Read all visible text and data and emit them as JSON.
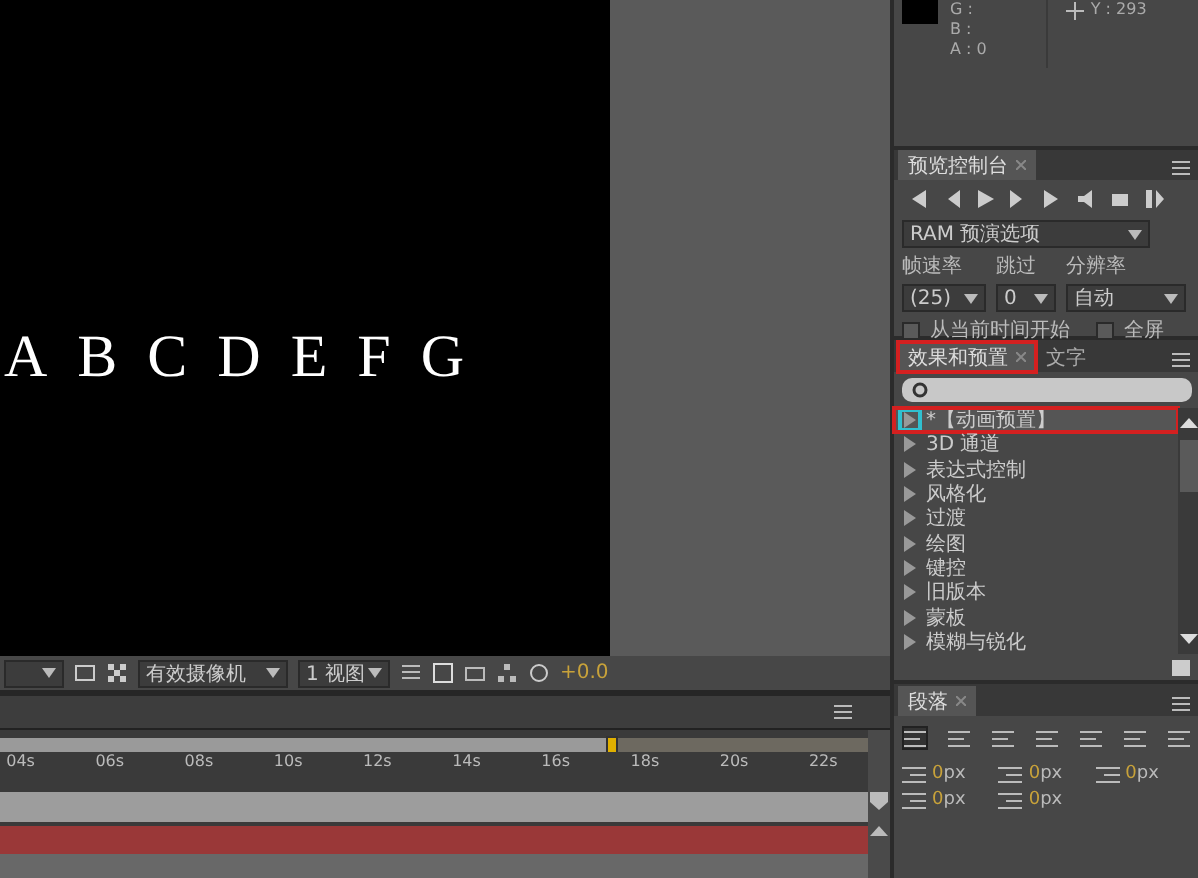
{
  "viewer": {
    "text": "ABCDEFG",
    "toolbar": {
      "camera": "有效摄像机",
      "views": "1 视图",
      "exposure": "+0.0"
    }
  },
  "timeline": {
    "ticks": [
      "04s",
      "06s",
      "08s",
      "10s",
      "12s",
      "14s",
      "16s",
      "18s",
      "20s",
      "22s"
    ]
  },
  "info": {
    "lines": [
      "G :",
      "B :",
      "A : 0"
    ],
    "coords": "Y : 293"
  },
  "preview": {
    "tab": "预览控制台",
    "ram_options": "RAM 预演选项",
    "labels": [
      "帧速率",
      "跳过",
      "分辨率"
    ],
    "frame_rate": "(25)",
    "skip": "0",
    "resolution": "自动",
    "checkboxes": [
      {
        "label": "从当前时间开始",
        "checked": false
      },
      {
        "label": "全屏",
        "checked": false
      }
    ]
  },
  "effects": {
    "tabs": [
      {
        "label": "效果和预置",
        "selected": true,
        "annotated": true
      },
      {
        "label": "文字",
        "selected": false,
        "annotated": false
      }
    ],
    "items": [
      {
        "label": "*【动画预置】",
        "selected": true,
        "annotated": true
      },
      {
        "label": "3D 通道",
        "selected": false,
        "annotated": false
      },
      {
        "label": "表达式控制",
        "selected": false,
        "annotated": false
      },
      {
        "label": "风格化",
        "selected": false,
        "annotated": false
      },
      {
        "label": "过渡",
        "selected": false,
        "annotated": false
      },
      {
        "label": "绘图",
        "selected": false,
        "annotated": false
      },
      {
        "label": "键控",
        "selected": false,
        "annotated": false
      },
      {
        "label": "旧版本",
        "selected": false,
        "annotated": false
      },
      {
        "label": "蒙板",
        "selected": false,
        "annotated": false
      },
      {
        "label": "模糊与锐化",
        "selected": false,
        "annotated": false
      }
    ]
  },
  "paragraph": {
    "tab": "段落",
    "align": [
      {
        "selected": true
      },
      {
        "selected": false
      },
      {
        "selected": false
      },
      {
        "selected": false
      },
      {
        "selected": false
      },
      {
        "selected": false
      },
      {
        "selected": false
      }
    ],
    "indents": [
      {
        "value": "0",
        "unit": "px"
      },
      {
        "value": "0",
        "unit": "px"
      },
      {
        "value": "0",
        "unit": "px"
      },
      {
        "value": "0",
        "unit": "px"
      },
      {
        "value": "0",
        "unit": "px"
      }
    ]
  }
}
